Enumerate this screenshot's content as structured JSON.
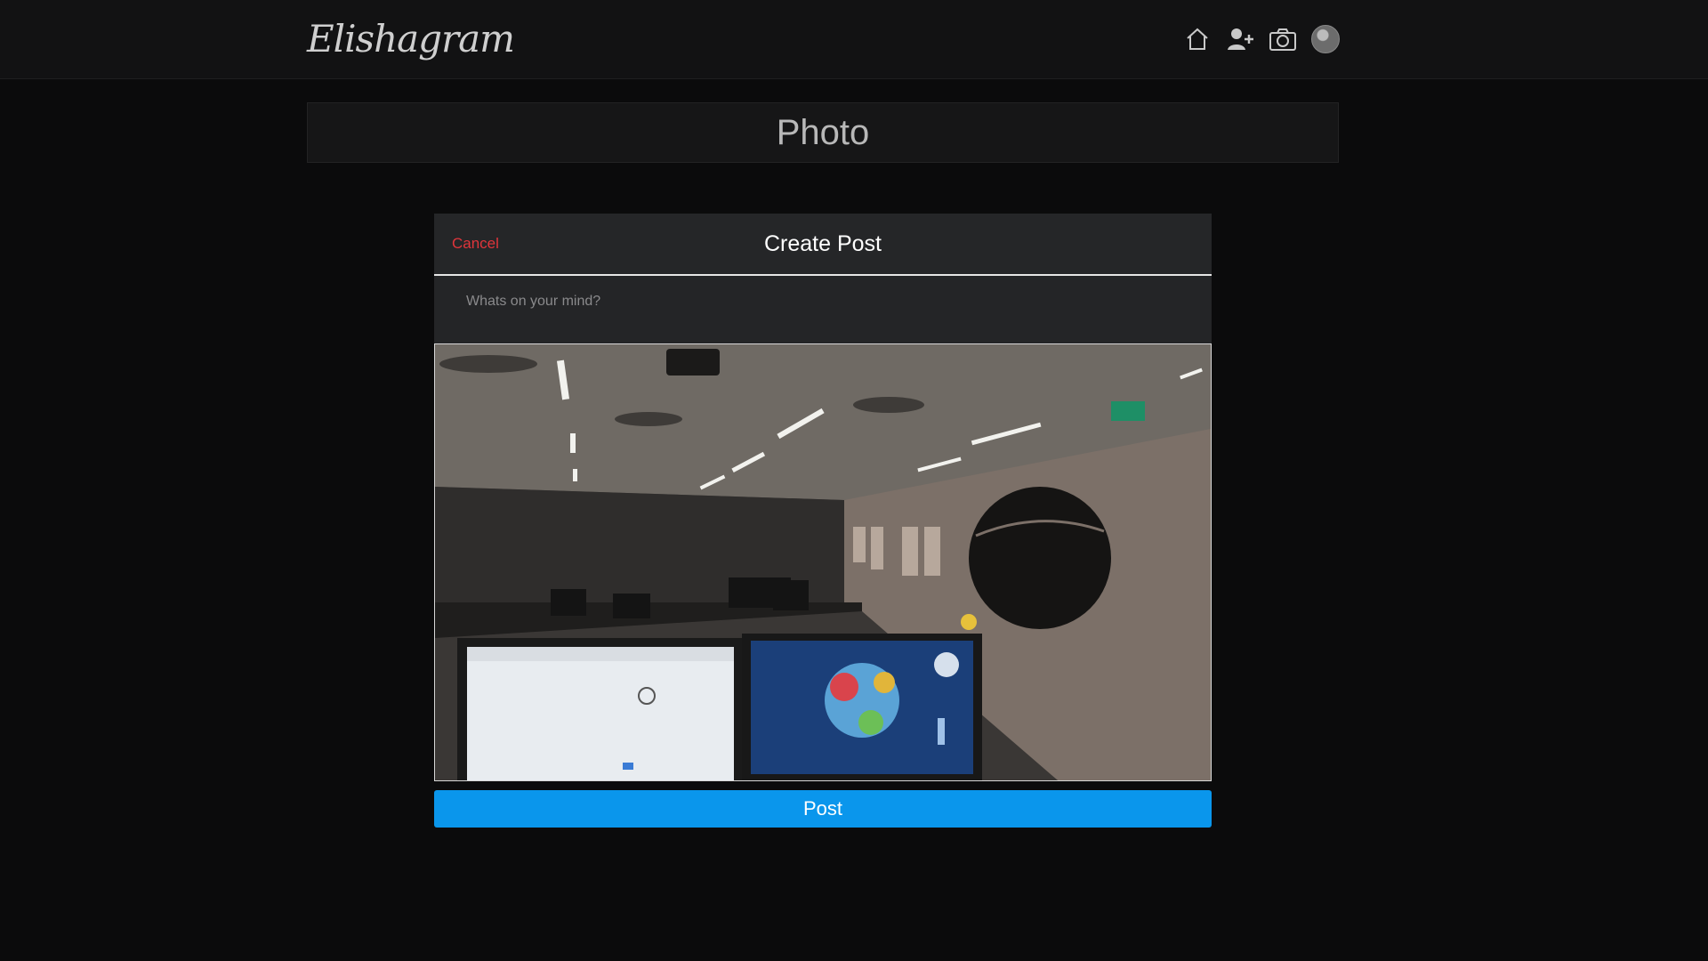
{
  "app": {
    "brand": "Elishagram"
  },
  "nav": {
    "icons": [
      "home-icon",
      "add-user-icon",
      "camera-icon",
      "avatar"
    ]
  },
  "page": {
    "title": "Photo"
  },
  "modal": {
    "cancel_label": "Cancel",
    "title": "Create Post",
    "caption_placeholder": "Whats on your mind?",
    "caption_value": "",
    "post_label": "Post"
  },
  "colors": {
    "background": "#0b0b0c",
    "cancel": "#e0353b",
    "post_button": "#0a96ec"
  }
}
